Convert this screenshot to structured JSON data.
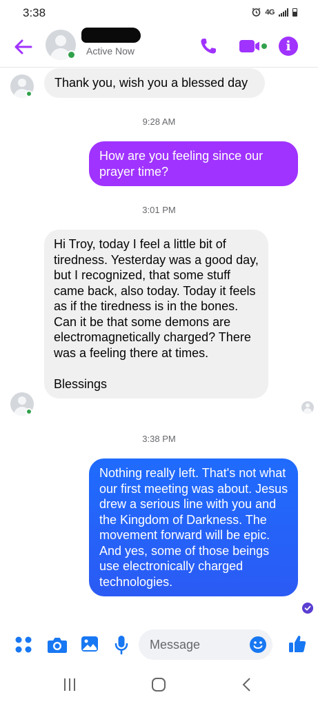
{
  "status_bar": {
    "time": "3:38",
    "network": "4G",
    "icons": [
      "alarm-icon",
      "signal-icon",
      "battery-icon"
    ]
  },
  "header": {
    "back_icon": "arrow-left-icon",
    "contact_name_redacted": true,
    "status": "Active Now",
    "actions": [
      "phone-icon",
      "video-icon",
      "info-icon"
    ],
    "accent_color": "#a033ff"
  },
  "messages": [
    {
      "direction": "incoming",
      "text": "Thank you, wish you a blessed day"
    },
    {
      "type": "timestamp",
      "text": "9:28 AM"
    },
    {
      "direction": "outgoing",
      "color": "#a033ff",
      "text": "How are you feeling since our prayer time?"
    },
    {
      "type": "timestamp",
      "text": "3:01 PM"
    },
    {
      "direction": "incoming",
      "text": "Hi Troy, today I feel a little bit of tiredness. Yesterday was a good day, but I recognized, that some stuff came back, also today. Today it feels as if the tiredness is in the bones. Can it be that some demons are electromagnetically charged? There was a feeling there at times.\n\nBlessings"
    },
    {
      "type": "timestamp",
      "text": "3:38 PM"
    },
    {
      "direction": "outgoing",
      "color": "#1f6bfd",
      "text": "Nothing really left.  That's not what our first meeting was about.  Jesus drew a serious line with you and the Kingdom of Darkness.  The movement forward will be epic.  And yes, some of those beings use electronically charged technologies."
    }
  ],
  "composer": {
    "placeholder": "Message",
    "actions": [
      "apps-icon",
      "camera-icon",
      "gallery-icon",
      "microphone-icon"
    ],
    "emoji_icon": "emoji-icon",
    "like_icon": "thumbs-up-icon"
  },
  "nav_bar": [
    "recent-apps-icon",
    "home-icon",
    "back-icon"
  ]
}
